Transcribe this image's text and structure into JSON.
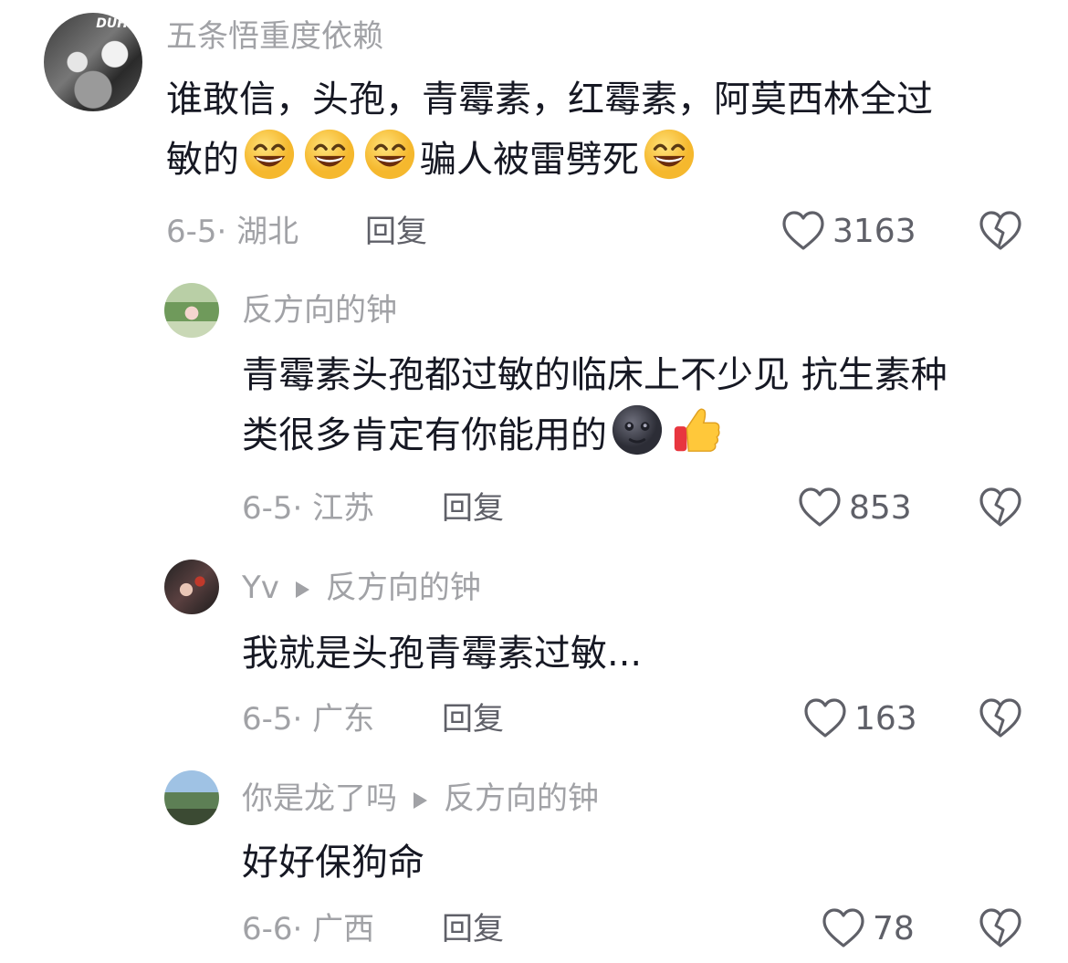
{
  "comments": [
    {
      "author": "五条悟重度依赖",
      "avatar_text": "DUH",
      "text_line1": "谁敢信，头孢，青霉素，红霉素，阿莫西林全过",
      "text_line2_part1": "敏的",
      "text_line2_part2": "骗人被雷劈死",
      "date_location": "6-5· 湖北",
      "reply_label": "回复",
      "likes": "3163"
    },
    {
      "author": "反方向的钟",
      "text_line1": "青霉素头孢都过敏的临床上不少见 抗生素种",
      "text_line2": "类很多肯定有你能用的",
      "date_location": "6-5· 江苏",
      "reply_label": "回复",
      "likes": "853"
    },
    {
      "author": "Yv",
      "reply_to": "反方向的钟",
      "text": "我就是头孢青霉素过敏...",
      "date_location": "6-5· 广东",
      "reply_label": "回复",
      "likes": "163"
    },
    {
      "author": "你是龙了吗",
      "reply_to": "反方向的钟",
      "text": "好好保狗命",
      "date_location": "6-6· 广西",
      "reply_label": "回复",
      "likes": "78"
    }
  ],
  "icons": {
    "like": "heart-outline-icon",
    "dislike": "broken-heart-icon",
    "reply_arrow": "play-triangle-icon",
    "emoji_grin": "grinning-face-emoji",
    "emoji_moon": "new-moon-face-emoji",
    "emoji_thumb": "thumbs-up-emoji"
  }
}
